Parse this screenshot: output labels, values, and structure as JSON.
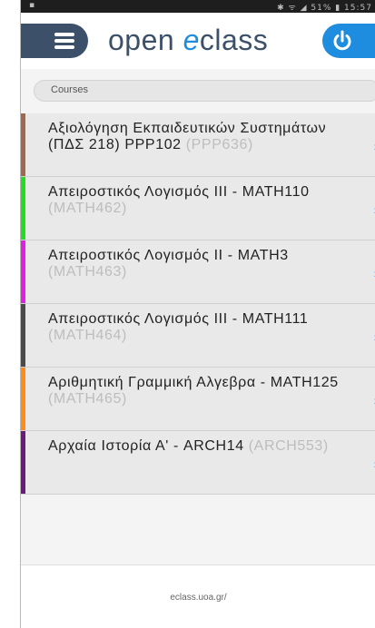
{
  "status_bar": {
    "left_icon": "▪",
    "right_text": "✱ ᯤ ◢ 51% ▮ 15:57"
  },
  "app": {
    "logo_open": "open ",
    "logo_e": "e",
    "logo_class": "class"
  },
  "breadcrumb": {
    "label": "Courses"
  },
  "courses": [
    {
      "title": "Αξιολόγηση Εκπαιδευτικών Συστημάτων (ΠΔΣ 218) PPP102",
      "code": "(PPP636)",
      "color": "#a0694b"
    },
    {
      "title": "Απειροστικός Λογισμός III - MATH110",
      "code": "(MATH462)",
      "color": "#22dd22"
    },
    {
      "title": "Απειροστικός Λογισμός II - MATH3",
      "code": "(MATH463)",
      "color": "#e21ee2"
    },
    {
      "title": "Απειροστικός Λογισμός III - MATH111",
      "code": "(MATH464)",
      "color": "#4a4a4a"
    },
    {
      "title": "Αριθμητική Γραμμική Αλγεβρα - MATH125",
      "code": "(MATH465)",
      "color": "#ff8c1a"
    },
    {
      "title": "Αρχαία Ιστορία Α' - ARCH14",
      "code": "(ARCH553)",
      "color": "#6a1a78"
    }
  ],
  "footer": {
    "url": "eclass.uoa.gr/"
  },
  "icons": {
    "menu": "hamburger-icon",
    "power": "power-icon",
    "chevron": "chevron-right-icon"
  },
  "colors": {
    "primary": "#3c5169",
    "accent": "#1f8ddf"
  }
}
